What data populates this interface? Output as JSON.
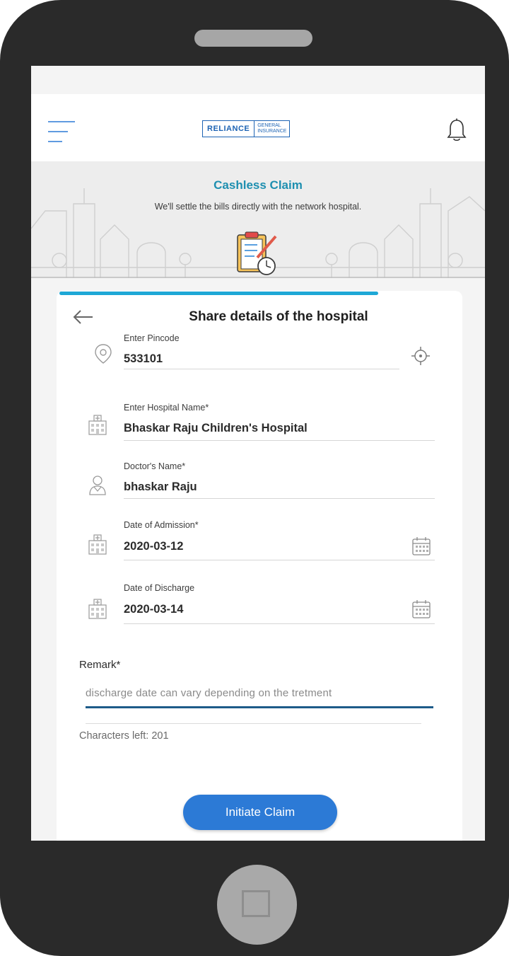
{
  "header": {
    "logo_brand": "RELIANCE",
    "logo_sub_1": "GENERAL",
    "logo_sub_2": "INSURANCE"
  },
  "banner": {
    "title": "Cashless Claim",
    "subtitle": "We'll settle the bills directly with the network hospital."
  },
  "form": {
    "title": "Share details of the hospital",
    "fields": [
      {
        "label": "Enter Pincode",
        "value": "533101",
        "icon": "location-pin-icon"
      },
      {
        "label": "Enter Hospital Name*",
        "value": "Bhaskar Raju Children's Hospital",
        "icon": "hospital-building-icon"
      },
      {
        "label": "Doctor's Name*",
        "value": "bhaskar Raju",
        "icon": "doctor-icon"
      },
      {
        "label": "Date of Admission*",
        "value": "2020-03-12",
        "icon": "hospital-building-icon"
      },
      {
        "label": "Date of Discharge",
        "value": "2020-03-14",
        "icon": "hospital-building-icon"
      }
    ],
    "remark_label": "Remark*",
    "remark_value": "discharge date can vary depending on the tretment",
    "chars_left": "Characters left: 201",
    "submit_label": "Initiate Claim"
  },
  "colors": {
    "accent": "#1ea8d6",
    "button": "#2c7ad6",
    "banner_title": "#1e8fb0",
    "remark_underline": "#1d5b89"
  }
}
